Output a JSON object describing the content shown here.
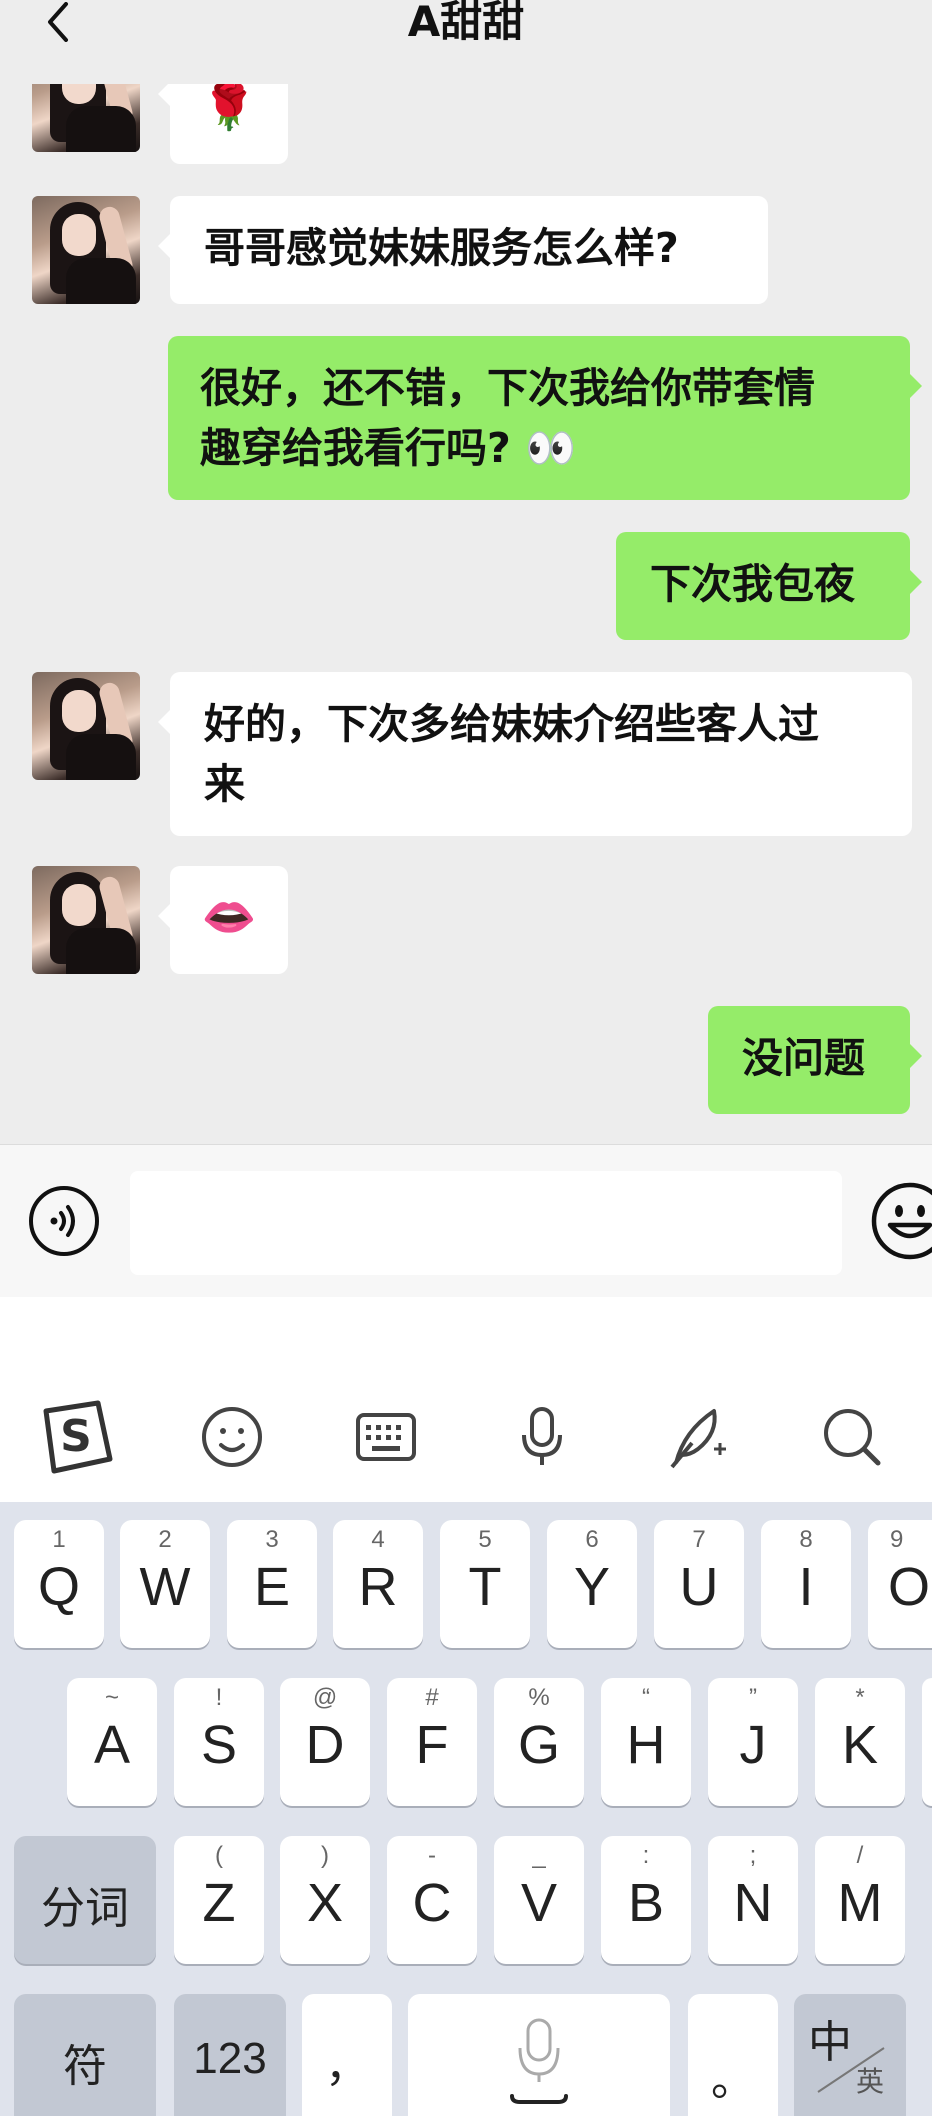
{
  "header": {
    "title": "A甜甜"
  },
  "messages": [
    {
      "side": "in",
      "text": "🌹"
    },
    {
      "side": "in",
      "text": "哥哥感觉妹妹服务怎么样?"
    },
    {
      "side": "out",
      "line1": "很好，还不错，下次我给你带套情",
      "line2": "趣穿给我看行吗? 👀"
    },
    {
      "side": "out",
      "text": "下次我包夜"
    },
    {
      "side": "in",
      "line1": "好的，下次多给妹妹介绍些客人过",
      "line2": "来"
    },
    {
      "side": "in",
      "text": "👄"
    },
    {
      "side": "out",
      "text": "没问题"
    }
  ],
  "keyboard": {
    "row1": [
      {
        "hint": "1",
        "key": "Q"
      },
      {
        "hint": "2",
        "key": "W"
      },
      {
        "hint": "3",
        "key": "E"
      },
      {
        "hint": "4",
        "key": "R"
      },
      {
        "hint": "5",
        "key": "T"
      },
      {
        "hint": "6",
        "key": "Y"
      },
      {
        "hint": "7",
        "key": "U"
      },
      {
        "hint": "8",
        "key": "I"
      },
      {
        "hint": "9",
        "key": "O"
      }
    ],
    "row2": [
      {
        "hint": "~",
        "key": "A"
      },
      {
        "hint": "!",
        "key": "S"
      },
      {
        "hint": "@",
        "key": "D"
      },
      {
        "hint": "#",
        "key": "F"
      },
      {
        "hint": "%",
        "key": "G"
      },
      {
        "hint": "“",
        "key": "H"
      },
      {
        "hint": "”",
        "key": "J"
      },
      {
        "hint": "*",
        "key": "K"
      }
    ],
    "row3": [
      {
        "hint": "(",
        "key": "Z"
      },
      {
        "hint": ")",
        "key": "X"
      },
      {
        "hint": "-",
        "key": "C"
      },
      {
        "hint": "_",
        "key": "V"
      },
      {
        "hint": ":",
        "key": "B"
      },
      {
        "hint": ";",
        "key": "N"
      },
      {
        "hint": "/",
        "key": "M"
      }
    ],
    "fenci": "分词",
    "fu": "符",
    "num": "123",
    "comma": "，",
    "period": "。",
    "zhong": "中",
    "ying": "英"
  }
}
